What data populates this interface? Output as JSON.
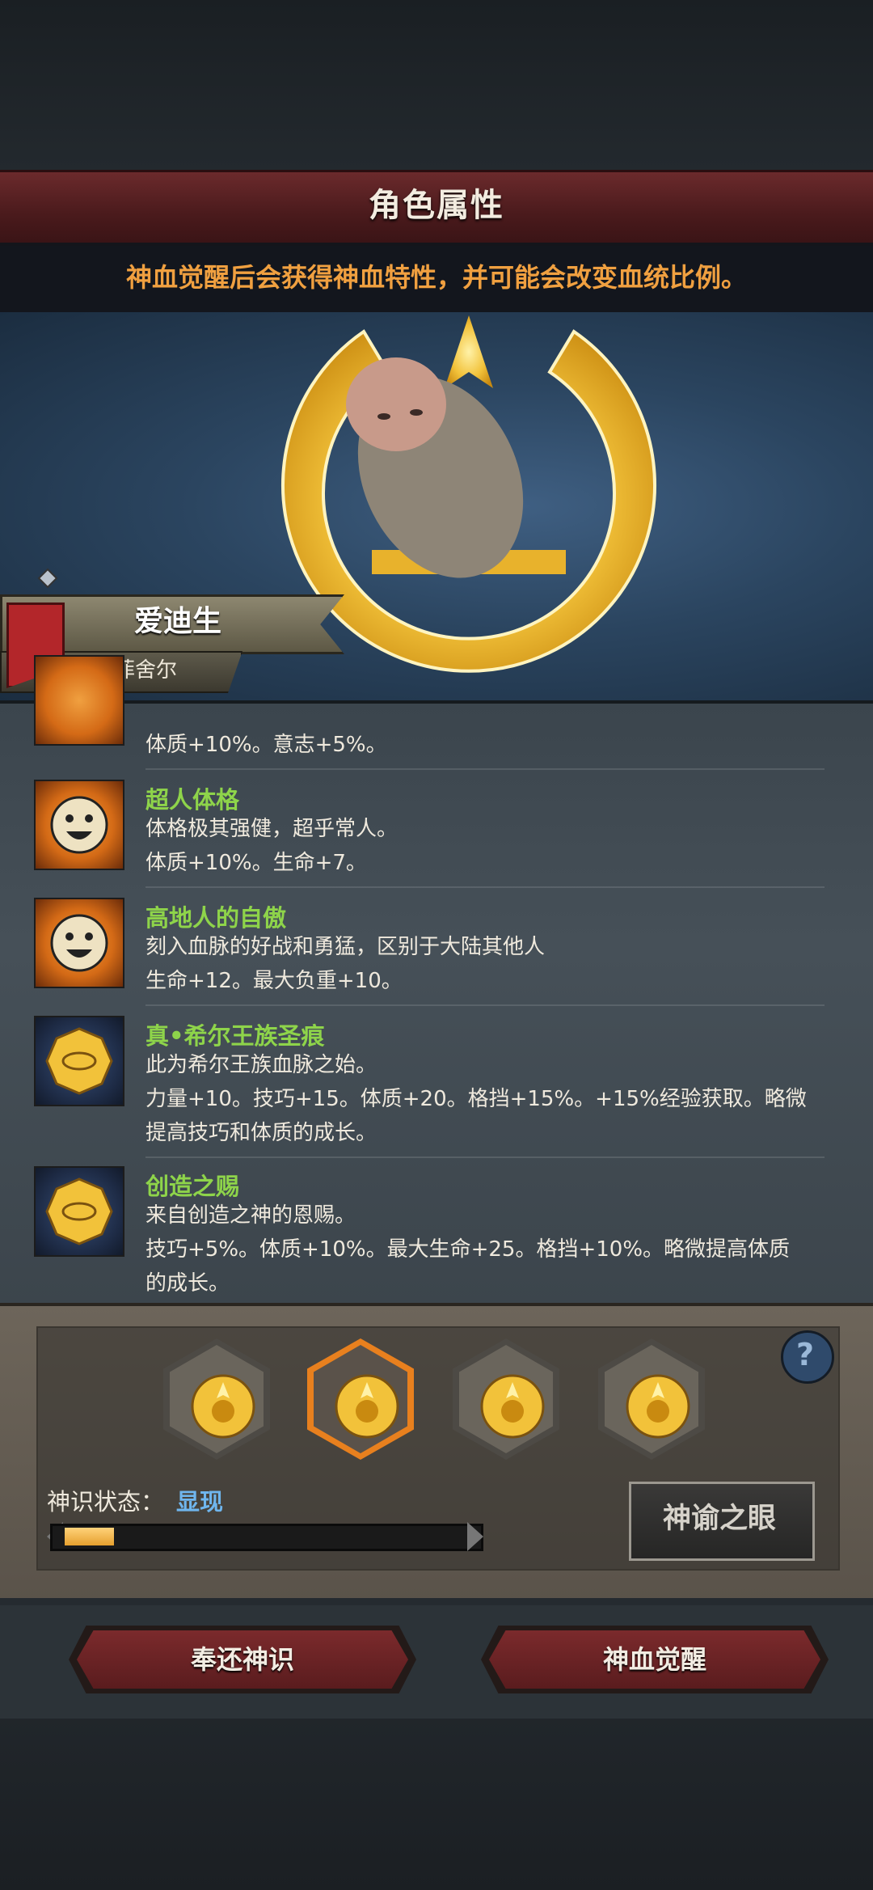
{
  "header": {
    "title": "角色属性",
    "hint": "神血觉醒后会获得神血特性，并可能会改变血统比例。"
  },
  "character": {
    "name": "爱迪生",
    "origin": "菲舍尔"
  },
  "traits": [
    {
      "name": "",
      "desc": "",
      "effect": "体质+10%。意志+5%。",
      "icon": "smiley-face-icon"
    },
    {
      "name": "超人体格",
      "desc": "体格极其强健，超乎常人。",
      "effect": "体质+10%。生命+7。",
      "icon": "smiley-face-icon"
    },
    {
      "name": "高地人的自傲",
      "desc": "刻入血脉的好战和勇猛，区别于大陆其他人",
      "effect": "生命+12。最大负重+10。",
      "icon": "smiley-face-icon"
    },
    {
      "name": "真•希尔王族圣痕",
      "desc": "此为希尔王族血脉之始。",
      "effect": "力量+10。技巧+15。体质+20。格挡+15%。+15%经验获取。略微",
      "effect2": "提高技巧和体质的成长。",
      "icon": "gold-sigil-icon"
    },
    {
      "name": "创造之赐",
      "desc": "来自创造之神的恩赐。",
      "effect": "技巧+5%。体质+10%。最大生命+25。格挡+10%。略微提高体质",
      "effect2": "的成长。",
      "icon": "gold-sigil-icon"
    }
  ],
  "god_panel": {
    "state_label": "神识状态：",
    "state_value": "显现",
    "progress": 0.12,
    "oracle_button": "神谕之眼",
    "help": "?",
    "selected_slot": 1
  },
  "buttons": {
    "return": "奉还神识",
    "awaken": "神血觉醒"
  },
  "colors": {
    "accent_orange": "#f0a040",
    "trait_green": "#8ed44a",
    "state_blue": "#6fb6ee"
  }
}
